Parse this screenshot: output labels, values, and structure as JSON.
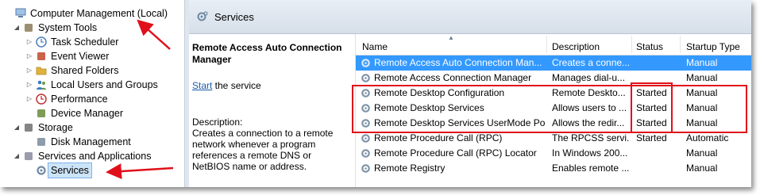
{
  "tree": {
    "items": [
      {
        "label": "Computer Management (Local)",
        "icon": "computer-icon",
        "indent": 0,
        "twisty": ""
      },
      {
        "label": "System Tools",
        "icon": "tools-icon",
        "indent": 1,
        "twisty": "◢"
      },
      {
        "label": "Task Scheduler",
        "icon": "clock-icon",
        "indent": 2,
        "twisty": "▷"
      },
      {
        "label": "Event Viewer",
        "icon": "event-viewer-icon",
        "indent": 2,
        "twisty": "▷"
      },
      {
        "label": "Shared Folders",
        "icon": "folder-icon",
        "indent": 2,
        "twisty": "▷"
      },
      {
        "label": "Local Users and Groups",
        "icon": "users-icon",
        "indent": 2,
        "twisty": "▷"
      },
      {
        "label": "Performance",
        "icon": "performance-icon",
        "indent": 2,
        "twisty": "▷"
      },
      {
        "label": "Device Manager",
        "icon": "device-manager-icon",
        "indent": 2,
        "twisty": ""
      },
      {
        "label": "Storage",
        "icon": "storage-icon",
        "indent": 1,
        "twisty": "◢"
      },
      {
        "label": "Disk Management",
        "icon": "disk-icon",
        "indent": 2,
        "twisty": ""
      },
      {
        "label": "Services and Applications",
        "icon": "services-apps-icon",
        "indent": 1,
        "twisty": "◢"
      },
      {
        "label": "Services",
        "icon": "gear-icon",
        "indent": 2,
        "twisty": "",
        "selected": true
      }
    ]
  },
  "header": {
    "title": "Services"
  },
  "description": {
    "service_name": "Remote Access Auto Connection Manager",
    "start_link": "Start",
    "start_suffix": " the service",
    "label": "Description:",
    "text": "Creates a connection to a remote network whenever a program references a remote DNS or NetBIOS name or address."
  },
  "table": {
    "columns": [
      "Name",
      "Description",
      "Status",
      "Startup Type"
    ],
    "rows": [
      {
        "name": "Remote Access Auto Connection Man...",
        "description": "Creates a conne...",
        "status": "",
        "startup": "Manual",
        "selected": true
      },
      {
        "name": "Remote Access Connection Manager",
        "description": "Manages dial-u...",
        "status": "",
        "startup": "Manual"
      },
      {
        "name": "Remote Desktop Configuration",
        "description": "Remote Deskto...",
        "status": "Started",
        "startup": "Manual"
      },
      {
        "name": "Remote Desktop Services",
        "description": "Allows users to ...",
        "status": "Started",
        "startup": "Manual"
      },
      {
        "name": "Remote Desktop Services UserMode Po...",
        "description": "Allows the redir...",
        "status": "Started",
        "startup": "Manual"
      },
      {
        "name": "Remote Procedure Call (RPC)",
        "description": "The RPCSS servi...",
        "status": "Started",
        "startup": "Automatic"
      },
      {
        "name": "Remote Procedure Call (RPC) Locator",
        "description": "In Windows 200...",
        "status": "",
        "startup": "Manual"
      },
      {
        "name": "Remote Registry",
        "description": "Enables remote ...",
        "status": "",
        "startup": "Manual"
      }
    ]
  },
  "colors": {
    "annotation_red": "#e0101a",
    "selection_blue": "#3399ff"
  }
}
